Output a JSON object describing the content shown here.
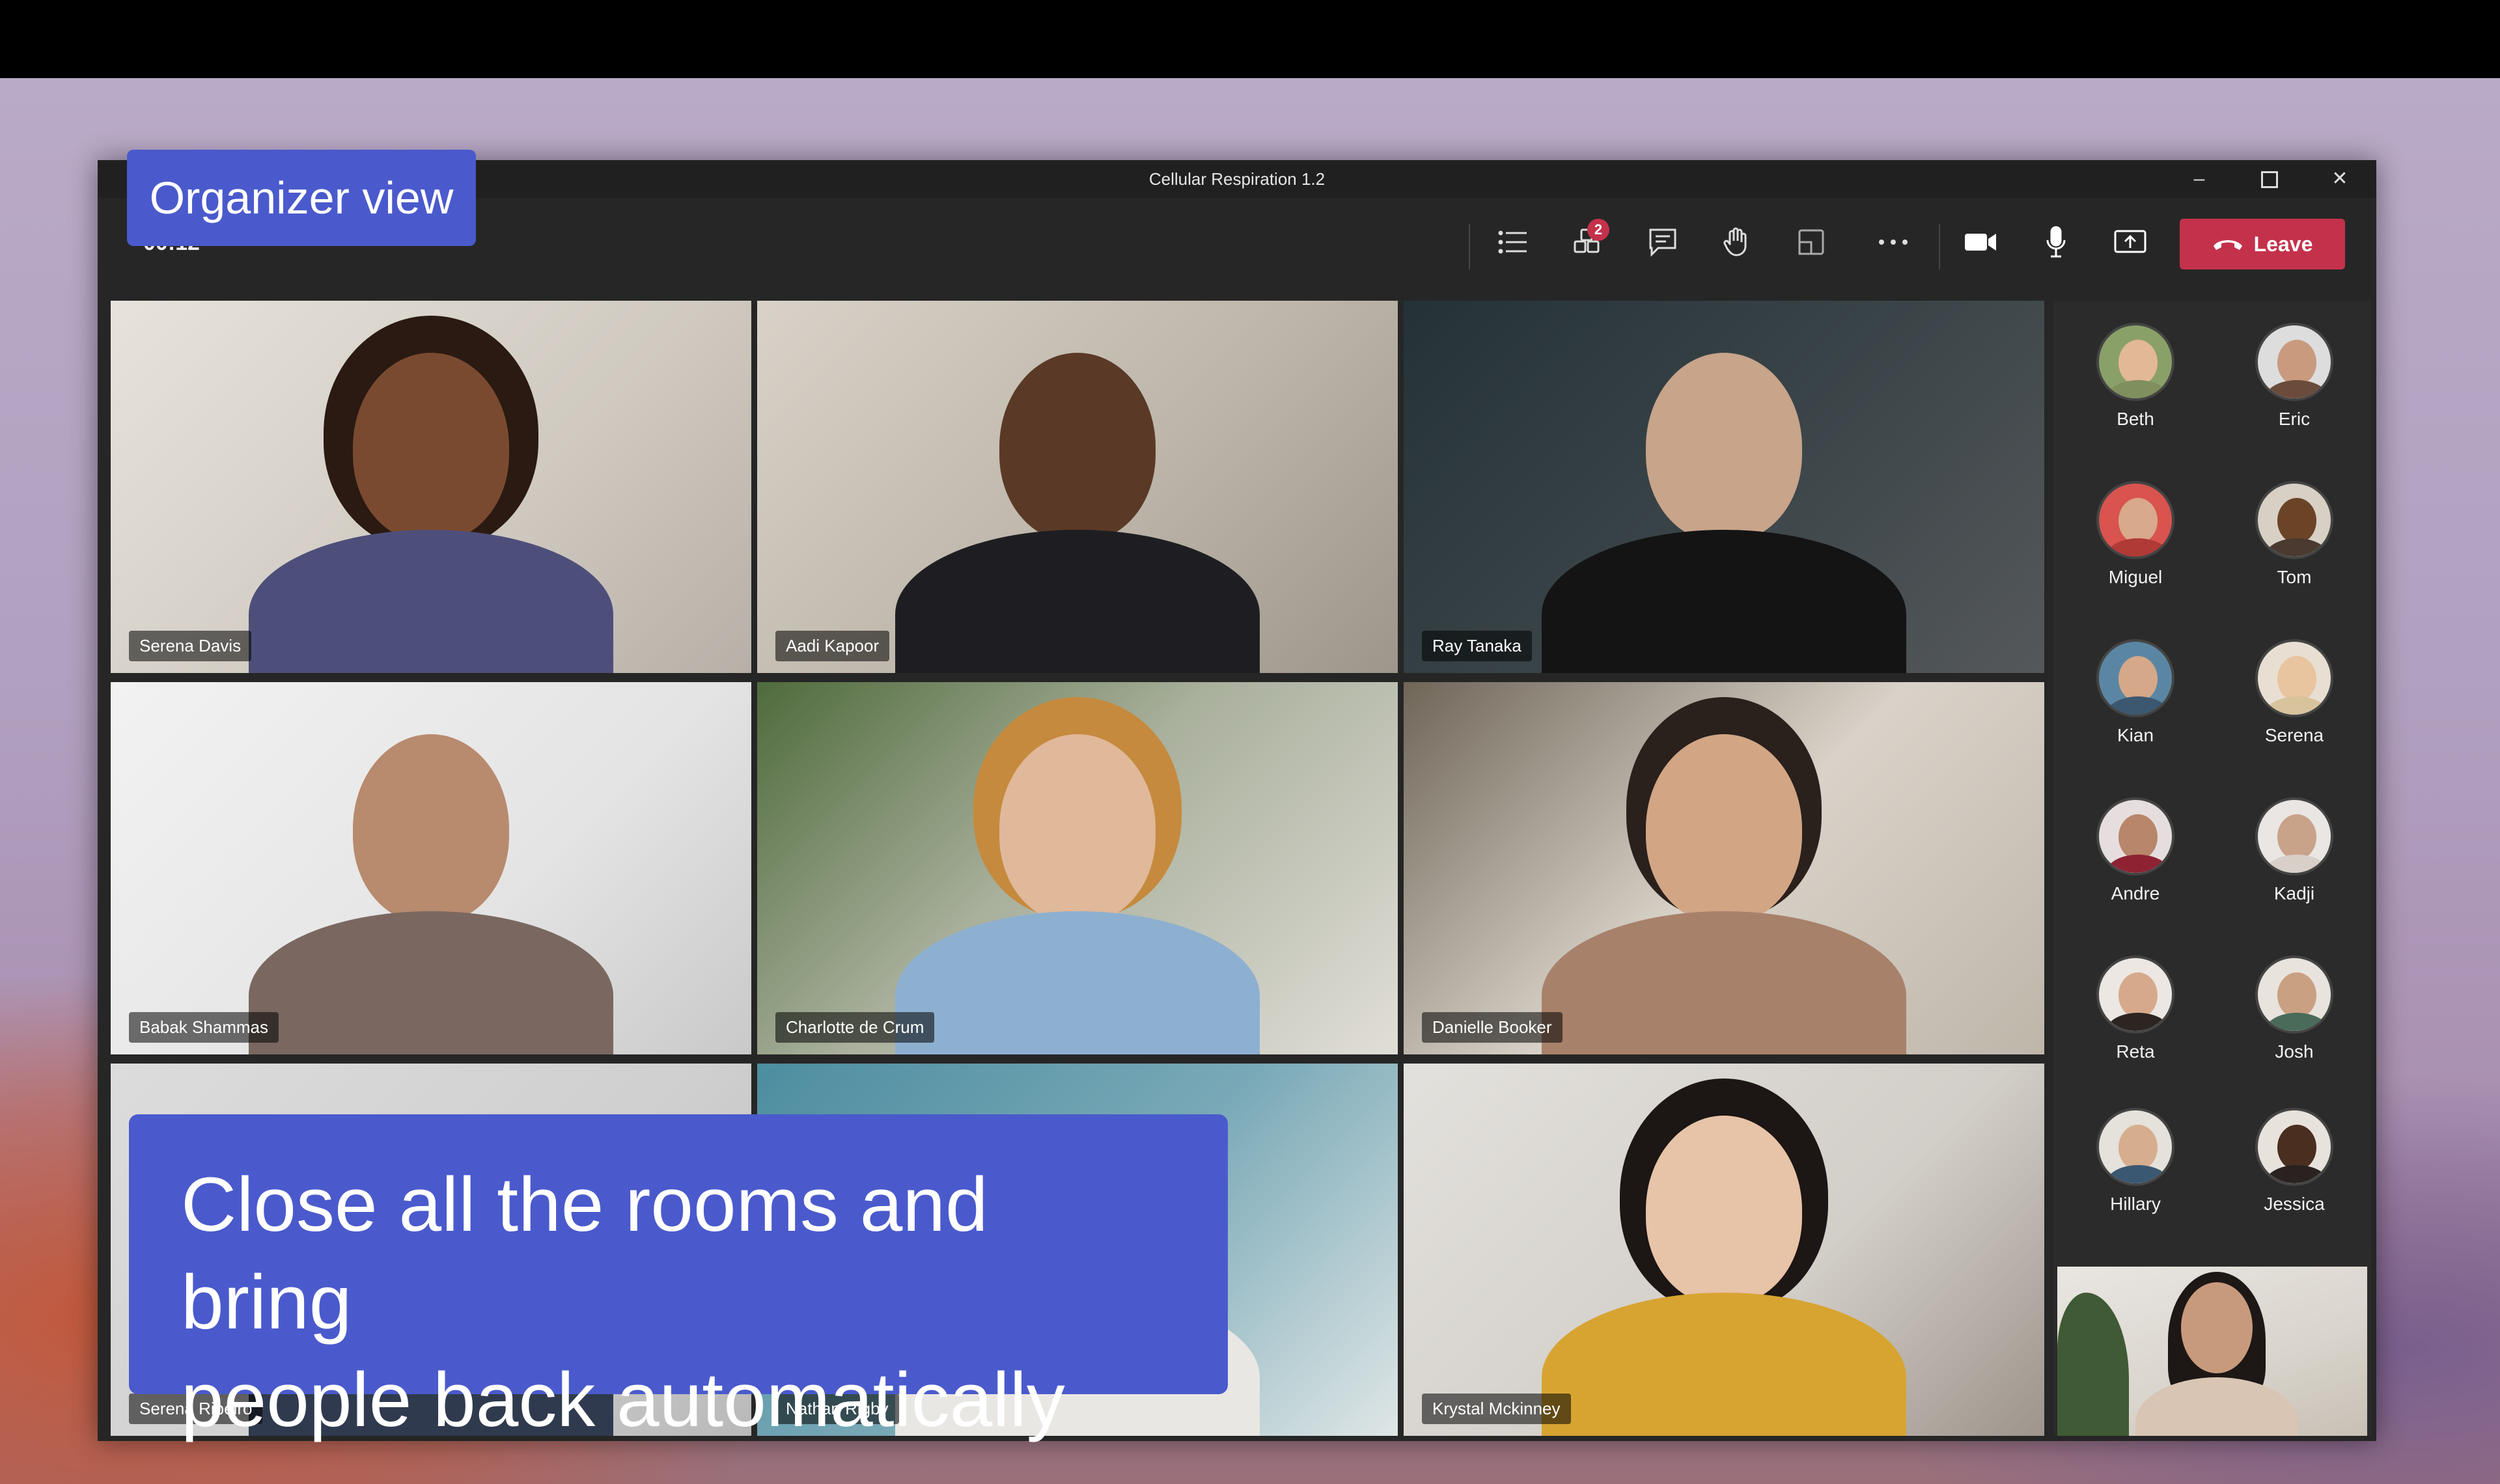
{
  "window": {
    "title": "Cellular Respiration 1.2",
    "timer": "00:12",
    "controls": {
      "minimize": "–",
      "maximize": "□",
      "close": "✕"
    }
  },
  "toolbar": {
    "icons": [
      "participants-list-icon",
      "breakout-rooms-icon",
      "chat-icon",
      "raise-hand-icon",
      "share-tray-icon",
      "more-options-icon",
      "camera-icon",
      "microphone-icon",
      "share-screen-icon"
    ],
    "breakout_badge": "2",
    "leave_label": "Leave",
    "leave_color": "#c4314b"
  },
  "video_tiles": [
    {
      "name": "Serena Davis"
    },
    {
      "name": "Aadi Kapoor"
    },
    {
      "name": "Ray Tanaka"
    },
    {
      "name": "Babak Shammas"
    },
    {
      "name": "Charlotte de Crum"
    },
    {
      "name": "Danielle Booker"
    },
    {
      "name": "Serena Ribeiro"
    },
    {
      "name": "Nathan Rigby"
    },
    {
      "name": "Krystal Mckinney"
    }
  ],
  "roster": [
    {
      "name": "Beth"
    },
    {
      "name": "Eric"
    },
    {
      "name": "Miguel"
    },
    {
      "name": "Tom"
    },
    {
      "name": "Kian"
    },
    {
      "name": "Serena"
    },
    {
      "name": "Andre"
    },
    {
      "name": "Kadji"
    },
    {
      "name": "Reta"
    },
    {
      "name": "Josh"
    },
    {
      "name": "Hillary"
    },
    {
      "name": "Jessica"
    }
  ],
  "overlay": {
    "organizer_label": "Organizer view",
    "caption_line1": "Close all the rooms and bring",
    "caption_line2": "people back automatically",
    "accent_color": "#4a5acc"
  }
}
